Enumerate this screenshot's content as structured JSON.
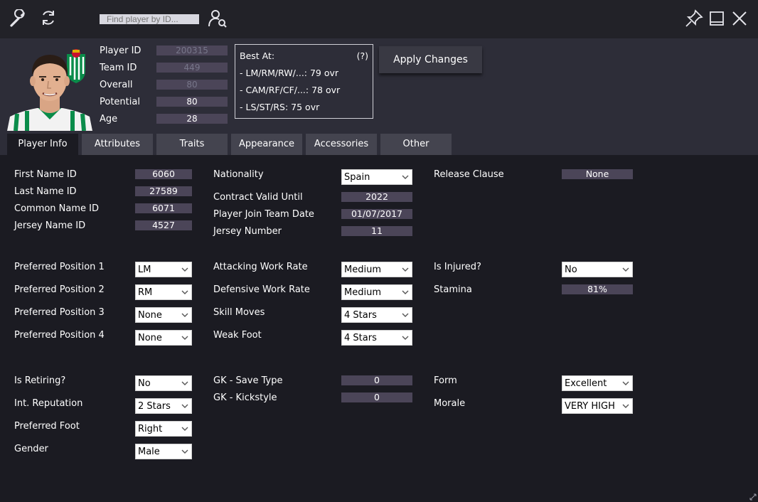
{
  "toolbar": {
    "search_placeholder": "Find player by ID..."
  },
  "header": {
    "fields": [
      {
        "label": "Player ID",
        "value": "200315"
      },
      {
        "label": "Team ID",
        "value": "449"
      },
      {
        "label": "Overall",
        "value": "80"
      },
      {
        "label": "Potential",
        "value": "80"
      },
      {
        "label": "Age",
        "value": "28"
      }
    ],
    "best_at": {
      "title": "Best At:",
      "help": "(?)",
      "lines": [
        "- LM/RM/RW/...: 79 ovr",
        "- CAM/RF/CF/...: 78 ovr",
        "- LS/ST/RS: 75 ovr"
      ]
    },
    "apply_label": "Apply Changes"
  },
  "tabs": [
    "Player Info",
    "Attributes",
    "Traits",
    "Appearance",
    "Accessories",
    "Other"
  ],
  "form": {
    "first_name_id": {
      "label": "First Name ID",
      "value": "6060"
    },
    "last_name_id": {
      "label": "Last Name ID",
      "value": "27589"
    },
    "common_name_id": {
      "label": "Common Name ID",
      "value": "6071"
    },
    "jersey_name_id": {
      "label": "Jersey Name ID",
      "value": "4527"
    },
    "nationality": {
      "label": "Nationality",
      "value": "Spain"
    },
    "contract_valid_until": {
      "label": "Contract Valid Until",
      "value": "2022"
    },
    "join_team_date": {
      "label": "Player Join Team Date",
      "value": "01/07/2017"
    },
    "jersey_number": {
      "label": "Jersey Number",
      "value": "11"
    },
    "release_clause": {
      "label": "Release Clause",
      "value": "None"
    },
    "pref_pos_1": {
      "label": "Preferred Position 1",
      "value": "LM"
    },
    "pref_pos_2": {
      "label": "Preferred Position 2",
      "value": "RM"
    },
    "pref_pos_3": {
      "label": "Preferred Position 3",
      "value": "None"
    },
    "pref_pos_4": {
      "label": "Preferred Position 4",
      "value": "None"
    },
    "attacking_work_rate": {
      "label": "Attacking Work Rate",
      "value": "Medium"
    },
    "defensive_work_rate": {
      "label": "Defensive Work Rate",
      "value": "Medium"
    },
    "skill_moves": {
      "label": "Skill Moves",
      "value": "4 Stars"
    },
    "weak_foot": {
      "label": "Weak Foot",
      "value": "4 Stars"
    },
    "is_injured": {
      "label": "Is Injured?",
      "value": "No"
    },
    "stamina": {
      "label": "Stamina",
      "value": "81%"
    },
    "is_retiring": {
      "label": "Is Retiring?",
      "value": "No"
    },
    "int_reputation": {
      "label": "Int. Reputation",
      "value": "2 Stars"
    },
    "preferred_foot": {
      "label": "Preferred Foot",
      "value": "Right"
    },
    "gender": {
      "label": "Gender",
      "value": "Male"
    },
    "gk_save_type": {
      "label": "GK - Save Type",
      "value": "0"
    },
    "gk_kickstyle": {
      "label": "GK - Kickstyle",
      "value": "0"
    },
    "form": {
      "label": "Form",
      "value": "Excellent"
    },
    "morale": {
      "label": "Morale",
      "value": "VERY HIGH"
    }
  },
  "icons": {
    "settings": "wrench-icon",
    "refresh": "refresh-icon",
    "find_user": "user-search-icon",
    "pin": "pin-icon",
    "minimize": "minimize-icon",
    "close": "close-icon",
    "resize": "resize-grip-icon"
  },
  "colors": {
    "background": "#1b1b22",
    "header_bg": "#2d2d38",
    "field_bg": "#4b4558",
    "tab_bg": "#44444f",
    "club_green": "#0a8c4a"
  }
}
